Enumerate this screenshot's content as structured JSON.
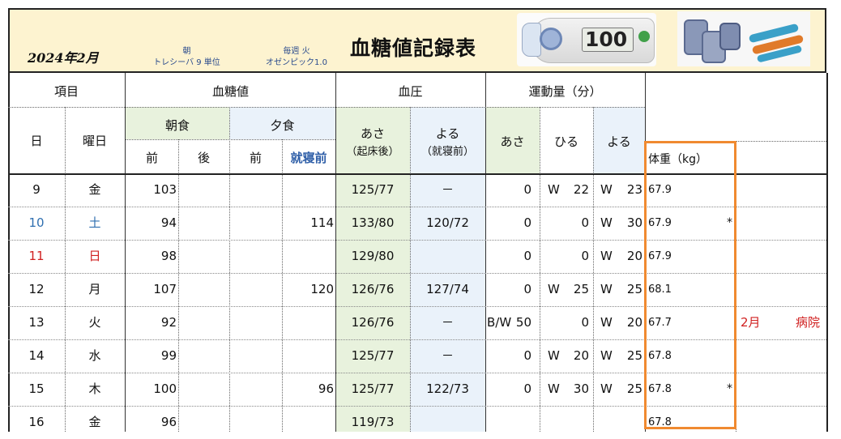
{
  "header": {
    "date": "2024年2月",
    "med1": {
      "line1": "朝",
      "line2": "トレシーバ 9 単位"
    },
    "med2": {
      "line1": "毎週 火",
      "line2": "オゼンピック1.0"
    },
    "title": "血糖値記録表",
    "meter_reading": "100"
  },
  "colors": {
    "header_bg": "#fdf3d0",
    "green_bg": "#e8f2dd",
    "blue_bg": "#eaf2fa",
    "saturday": "#2f6fb0",
    "sunday": "#d02020",
    "highlight": "#f08a30",
    "bedtime_label": "#2f5fa8"
  },
  "columns": {
    "item": "項目",
    "glucose": "血糖値",
    "bp": "血圧",
    "exercise": "運動量（分）",
    "day": "日",
    "weekday": "曜日",
    "breakfast": "朝食",
    "dinner": "夕食",
    "before": "前",
    "after": "後",
    "dinner_before": "前",
    "bedtime": "就寝前",
    "bp_morning": "あさ",
    "bp_morning_sub": "（起床後）",
    "bp_night": "よる",
    "bp_night_sub": "（就寝前）",
    "ex_morning": "あさ",
    "ex_noon": "ひる",
    "ex_night": "よる",
    "weight": "体重（kg）"
  },
  "rows": [
    {
      "day": "9",
      "wd": "金",
      "b_before": "103",
      "b_after": "",
      "d_before": "",
      "bedtime": "",
      "bp_m": "125/77",
      "bp_n": "－",
      "ex_m": "0",
      "ex_n_pre": "W",
      "ex_n": "22",
      "ex_e_pre": "W",
      "ex_e": "23",
      "weight": "67.9",
      "mark": "",
      "note1": "",
      "note2": ""
    },
    {
      "day": "10",
      "wd": "土",
      "b_before": "94",
      "b_after": "",
      "d_before": "",
      "bedtime": "114",
      "bp_m": "133/80",
      "bp_n": "120/72",
      "ex_m": "0",
      "ex_n_pre": "",
      "ex_n": "0",
      "ex_e_pre": "W",
      "ex_e": "30",
      "weight": "67.9",
      "mark": "*",
      "note1": "",
      "note2": ""
    },
    {
      "day": "11",
      "wd": "日",
      "b_before": "98",
      "b_after": "",
      "d_before": "",
      "bedtime": "",
      "bp_m": "129/80",
      "bp_n": "",
      "ex_m": "0",
      "ex_n_pre": "",
      "ex_n": "0",
      "ex_e_pre": "W",
      "ex_e": "20",
      "weight": "67.9",
      "mark": "",
      "note1": "",
      "note2": ""
    },
    {
      "day": "12",
      "wd": "月",
      "b_before": "107",
      "b_after": "",
      "d_before": "",
      "bedtime": "120",
      "bp_m": "126/76",
      "bp_n": "127/74",
      "ex_m": "0",
      "ex_n_pre": "W",
      "ex_n": "25",
      "ex_e_pre": "W",
      "ex_e": "25",
      "weight": "68.1",
      "mark": "",
      "note1": "",
      "note2": ""
    },
    {
      "day": "13",
      "wd": "火",
      "b_before": "92",
      "b_after": "",
      "d_before": "",
      "bedtime": "",
      "bp_m": "126/76",
      "bp_n": "－",
      "ex_m_pre": "B/W",
      "ex_m": "50",
      "ex_n_pre": "",
      "ex_n": "0",
      "ex_e_pre": "W",
      "ex_e": "20",
      "weight": "67.7",
      "mark": "",
      "note1": "2月",
      "note2": "病院"
    },
    {
      "day": "14",
      "wd": "水",
      "b_before": "99",
      "b_after": "",
      "d_before": "",
      "bedtime": "",
      "bp_m": "125/77",
      "bp_n": "－",
      "ex_m": "0",
      "ex_n_pre": "W",
      "ex_n": "20",
      "ex_e_pre": "W",
      "ex_e": "25",
      "weight": "67.8",
      "mark": "",
      "note1": "",
      "note2": ""
    },
    {
      "day": "15",
      "wd": "木",
      "b_before": "100",
      "b_after": "",
      "d_before": "",
      "bedtime": "96",
      "bp_m": "125/77",
      "bp_n": "122/73",
      "ex_m": "0",
      "ex_n_pre": "W",
      "ex_n": "30",
      "ex_e_pre": "W",
      "ex_e": "25",
      "weight": "67.8",
      "mark": "*",
      "note1": "",
      "note2": ""
    },
    {
      "day": "16",
      "wd": "金",
      "b_before": "96",
      "b_after": "",
      "d_before": "",
      "bedtime": "",
      "bp_m": "119/73",
      "bp_n": "",
      "ex_m": "",
      "ex_n_pre": "",
      "ex_n": "",
      "ex_e_pre": "",
      "ex_e": "",
      "weight": "67.8",
      "mark": "",
      "note1": "",
      "note2": ""
    }
  ]
}
